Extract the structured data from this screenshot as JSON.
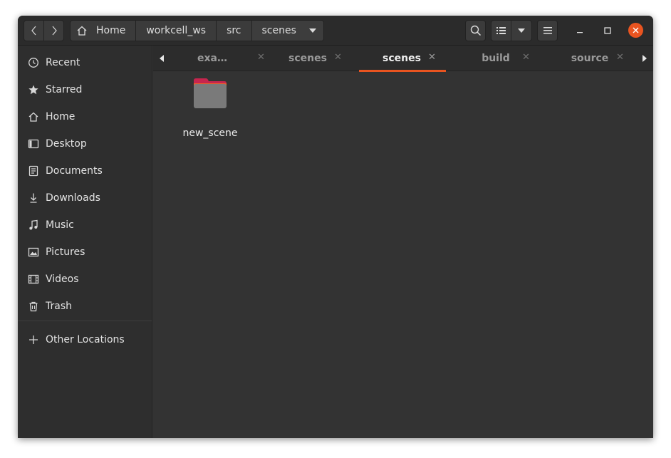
{
  "window": {
    "close_bg": "#e95420"
  },
  "pathbar": {
    "crumbs": [
      "Home",
      "workcell_ws",
      "src",
      "scenes"
    ]
  },
  "sidebar": {
    "items": [
      {
        "label": "Recent",
        "icon": "clock-icon"
      },
      {
        "label": "Starred",
        "icon": "star-icon"
      },
      {
        "label": "Home",
        "icon": "home-icon"
      },
      {
        "label": "Desktop",
        "icon": "desktop-icon"
      },
      {
        "label": "Documents",
        "icon": "document-icon"
      },
      {
        "label": "Downloads",
        "icon": "download-icon"
      },
      {
        "label": "Music",
        "icon": "music-icon"
      },
      {
        "label": "Pictures",
        "icon": "picture-icon"
      },
      {
        "label": "Videos",
        "icon": "film-icon"
      },
      {
        "label": "Trash",
        "icon": "trash-icon"
      }
    ],
    "other_locations": "Other Locations"
  },
  "tabs": [
    {
      "label": "exa…",
      "active": false
    },
    {
      "label": "scenes",
      "active": false
    },
    {
      "label": "scenes",
      "active": true
    },
    {
      "label": "build",
      "active": false
    },
    {
      "label": "source",
      "active": false
    }
  ],
  "files": [
    {
      "name": "new_scene",
      "type": "folder",
      "icon": "folder-icon"
    }
  ],
  "colors": {
    "accent": "#e95420",
    "folder": "#7a7a7a",
    "folder_tab": "#c7254e"
  }
}
